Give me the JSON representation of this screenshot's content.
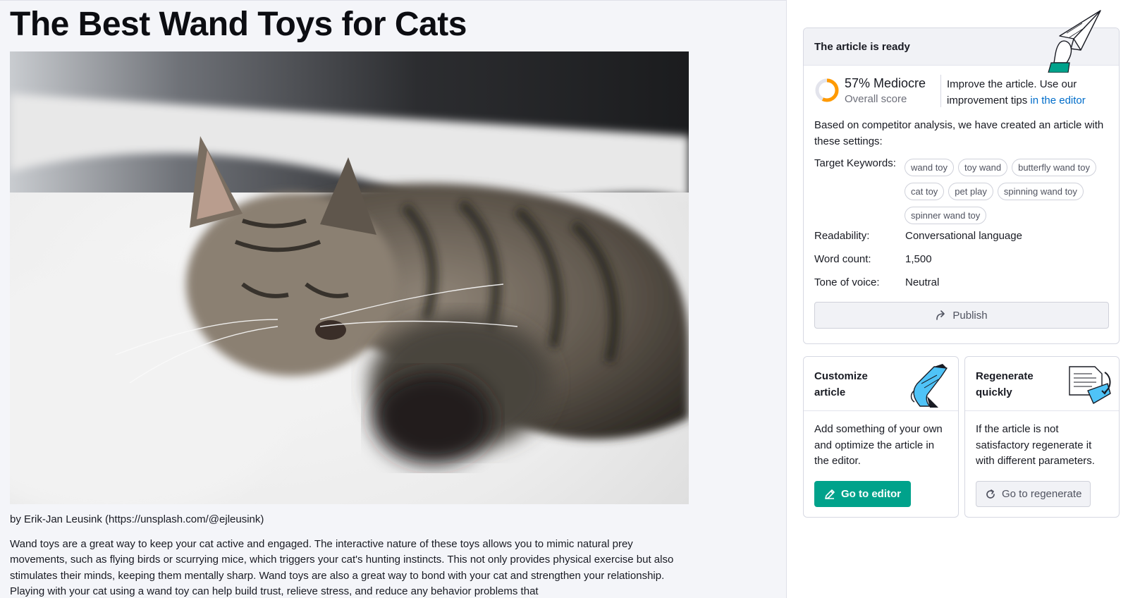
{
  "article": {
    "title": "The Best Wand Toys for Cats",
    "image_alt": "Sleeping tabby cat on a white blanket",
    "credit": "by Erik-Jan Leusink (https://unsplash.com/@ejleusink)",
    "paragraph": "Wand toys are a great way to keep your cat active and engaged. The interactive nature of these toys allows you to mimic natural prey movements, such as flying birds or scurrying mice, which triggers your cat's hunting instincts. This not only provides physical exercise but also stimulates their minds, keeping them mentally sharp. Wand toys are also a great way to bond with your cat and strengthen your relationship. Playing with your cat using a wand toy can help build trust, relieve stress, and reduce any behavior problems that"
  },
  "ready": {
    "title": "The article is ready",
    "score_value": "57% Mediocre",
    "score_percent": 57,
    "score_label": "Overall score",
    "tip_text": "Improve the article. Use our improvement tips ",
    "tip_link": "in the editor",
    "based_text": "Based on competitor analysis, we have created an article with these settings:",
    "keywords_label": "Target Keywords:",
    "keywords": [
      "wand toy",
      "toy wand",
      "butterfly wand toy",
      "cat toy",
      "pet play",
      "spinning wand toy",
      "spinner wand toy"
    ],
    "readability_label": "Readability:",
    "readability_value": "Conversational language",
    "wordcount_label": "Word count:",
    "wordcount_value": "1,500",
    "tone_label": "Tone of voice:",
    "tone_value": "Neutral",
    "publish_label": "Publish"
  },
  "customize": {
    "title": "Customize article",
    "description": "Add something of your own and optimize the article in the editor.",
    "button": "Go to editor"
  },
  "regenerate": {
    "title": "Regenerate quickly",
    "description": "If the article is not satisfactory regenerate it with different parameters.",
    "button": "Go to regenerate"
  },
  "colors": {
    "accent": "#00a28b",
    "score_ring": "#ff9a00",
    "link": "#006dca"
  }
}
